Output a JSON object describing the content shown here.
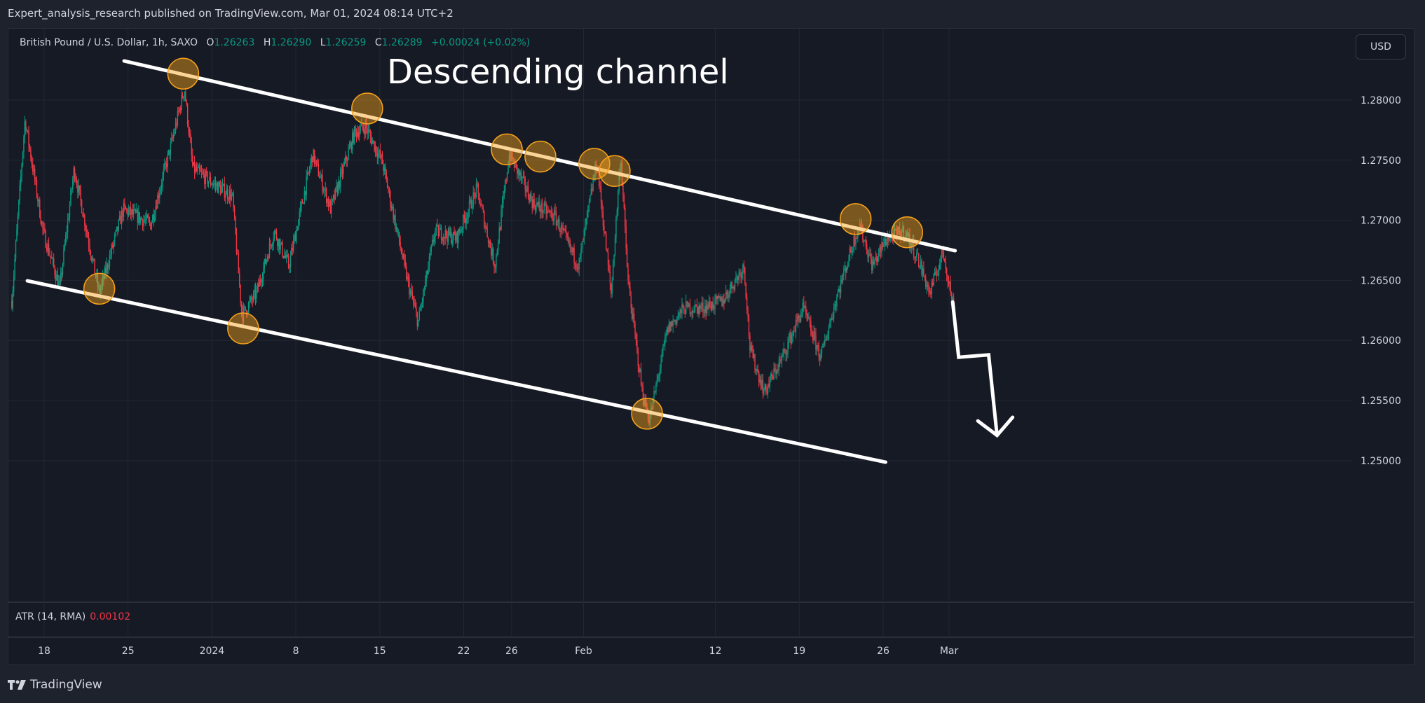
{
  "header": {
    "published": "Expert_analysis_research published on TradingView.com, Mar 01, 2024 08:14 UTC+2"
  },
  "legend": {
    "symbol": "British Pound / U.S. Dollar, 1h, SAXO",
    "o_label": "O",
    "o": "1.26263",
    "h_label": "H",
    "h": "1.26290",
    "l_label": "L",
    "l": "1.26259",
    "c_label": "C",
    "c": "1.26289",
    "change": "+0.00024 (+0.02%)"
  },
  "currency_button": "USD",
  "annotation_title": "Descending channel",
  "indicator": {
    "name": "ATR (14, RMA)",
    "value": "0.00102"
  },
  "footer": {
    "brand": "TradingView"
  },
  "colors": {
    "up": "#089981",
    "down": "#f23645",
    "line": "#ffffff",
    "circle": "#f7a21b"
  },
  "chart_data": {
    "type": "candlestick",
    "title": "Descending channel",
    "x_unit": "days since Dec 18, 2023",
    "xlim": [
      -2.9,
      108.7
    ],
    "ylim": [
      1.24947,
      1.28953
    ],
    "y_ticks": [
      "1.28000",
      "1.27500",
      "1.27000",
      "1.26500",
      "1.26000",
      "1.25500",
      "1.25000"
    ],
    "y_tick_values": [
      1.28,
      1.275,
      1.27,
      1.265,
      1.26,
      1.255,
      1.25
    ],
    "x_ticks": [
      {
        "label": "18",
        "day": 0
      },
      {
        "label": "25",
        "day": 7
      },
      {
        "label": "2024",
        "day": 14
      },
      {
        "label": "8",
        "day": 21
      },
      {
        "label": "15",
        "day": 28
      },
      {
        "label": "22",
        "day": 35
      },
      {
        "label": "26",
        "day": 39
      },
      {
        "label": "Feb",
        "day": 45
      },
      {
        "label": "12",
        "day": 56
      },
      {
        "label": "19",
        "day": 63
      },
      {
        "label": "26",
        "day": 70
      },
      {
        "label": "Mar",
        "day": 75.5
      }
    ],
    "price_path": [
      [
        -2.7,
        1.2633
      ],
      [
        -1.6,
        1.2784
      ],
      [
        -0.1,
        1.2691
      ],
      [
        1.3,
        1.2644
      ],
      [
        2.5,
        1.2743
      ],
      [
        4.6,
        1.2639
      ],
      [
        6.6,
        1.2709
      ],
      [
        8.9,
        1.2697
      ],
      [
        10.7,
        1.2767
      ],
      [
        11.7,
        1.281
      ],
      [
        12.4,
        1.2743
      ],
      [
        13.9,
        1.2732
      ],
      [
        15.7,
        1.272
      ],
      [
        16.5,
        1.2621
      ],
      [
        17.7,
        1.2639
      ],
      [
        19.2,
        1.2691
      ],
      [
        20.4,
        1.2662
      ],
      [
        22.4,
        1.2755
      ],
      [
        23.9,
        1.2709
      ],
      [
        25.9,
        1.2773
      ],
      [
        26.8,
        1.2778
      ],
      [
        28.2,
        1.2749
      ],
      [
        30.3,
        1.265
      ],
      [
        31.2,
        1.2615
      ],
      [
        32.6,
        1.2691
      ],
      [
        34.4,
        1.2685
      ],
      [
        36.1,
        1.2726
      ],
      [
        37.6,
        1.2662
      ],
      [
        38.8,
        1.2755
      ],
      [
        40.8,
        1.2714
      ],
      [
        42.6,
        1.2703
      ],
      [
        44.6,
        1.2662
      ],
      [
        46.1,
        1.2749
      ],
      [
        47.3,
        1.2639
      ],
      [
        48.1,
        1.2755
      ],
      [
        48.7,
        1.265
      ],
      [
        49.9,
        1.2557
      ],
      [
        50.5,
        1.2534
      ],
      [
        52.0,
        1.2609
      ],
      [
        53.4,
        1.2627
      ],
      [
        54.9,
        1.2627
      ],
      [
        56.6,
        1.2633
      ],
      [
        58.4,
        1.2662
      ],
      [
        58.9,
        1.2592
      ],
      [
        60.1,
        1.2557
      ],
      [
        61.6,
        1.2586
      ],
      [
        63.3,
        1.2627
      ],
      [
        64.8,
        1.2586
      ],
      [
        66.2,
        1.2639
      ],
      [
        68.0,
        1.2697
      ],
      [
        69.1,
        1.2662
      ],
      [
        70.3,
        1.2685
      ],
      [
        71.8,
        1.2691
      ],
      [
        72.9,
        1.2668
      ],
      [
        73.9,
        1.2639
      ],
      [
        75.0,
        1.2674
      ],
      [
        75.9,
        1.2627
      ]
    ],
    "channel_upper": [
      [
        6.67,
        1.28326
      ],
      [
        76.0,
        1.26747
      ]
    ],
    "channel_lower": [
      [
        -1.4,
        1.26496
      ],
      [
        70.2,
        1.24987
      ]
    ],
    "touch_points": [
      [
        11.6,
        1.2822
      ],
      [
        26.95,
        1.2793
      ],
      [
        38.6,
        1.2759
      ],
      [
        41.4,
        1.2753
      ],
      [
        45.9,
        1.2747
      ],
      [
        47.6,
        1.2741
      ],
      [
        67.7,
        1.2701
      ],
      [
        72.0,
        1.269
      ],
      [
        4.6,
        1.2643
      ],
      [
        16.6,
        1.261
      ],
      [
        50.3,
        1.2539
      ]
    ],
    "projection_arrow": [
      [
        75.8,
        1.2632
      ],
      [
        76.3,
        1.2586
      ],
      [
        78.8,
        1.2588
      ],
      [
        79.5,
        1.2521
      ]
    ],
    "arrow_head": [
      [
        77.9,
        1.2533
      ],
      [
        79.5,
        1.2521
      ],
      [
        80.8,
        1.2536
      ]
    ]
  }
}
